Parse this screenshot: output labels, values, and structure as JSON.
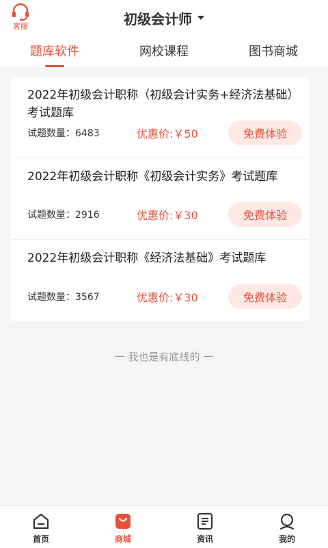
{
  "header": {
    "customer_service_label": "客服",
    "title": "初级会计师"
  },
  "tabs": [
    {
      "label": "题库软件",
      "active": true
    },
    {
      "label": "网校课程",
      "active": false
    },
    {
      "label": "图书商城",
      "active": false
    }
  ],
  "items": [
    {
      "title": "2022年初级会计职称（初级会计实务+经济法基础）考试题库",
      "count": "试题数量：6483",
      "price": "优惠价:￥50",
      "button": "免费体验"
    },
    {
      "title": "2022年初级会计职称《初级会计实务》考试题库",
      "count": "试题数量：2916",
      "price": "优惠价:￥30",
      "button": "免费体验"
    },
    {
      "title": "2022年初级会计职称《经济法基础》考试题库",
      "count": "试题数量：3567",
      "price": "优惠价:￥30",
      "button": "免费体验"
    }
  ],
  "footer_note": "一 我也是有底线的 一",
  "bottom_nav": [
    {
      "label": "首页",
      "icon": "home-icon",
      "active": false
    },
    {
      "label": "商城",
      "icon": "shop-icon",
      "active": true
    },
    {
      "label": "资讯",
      "icon": "news-icon",
      "active": false
    },
    {
      "label": "我的",
      "icon": "profile-icon",
      "active": false
    }
  ],
  "colors": {
    "accent": "#e8503a",
    "button_bg": "#fde8e4",
    "page_bg": "#f5f5f5"
  }
}
